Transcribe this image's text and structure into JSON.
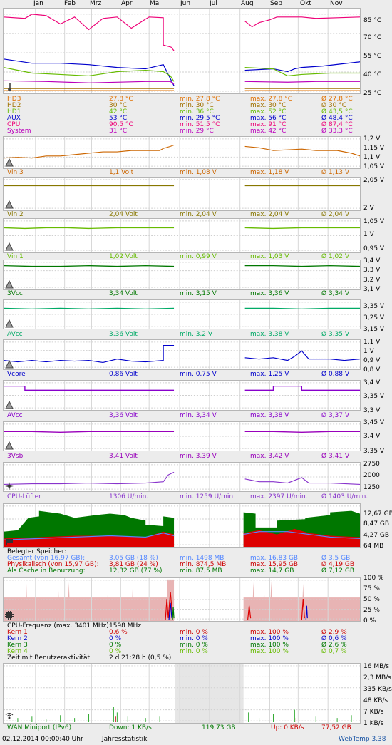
{
  "months": [
    "Jan",
    "Feb",
    "Mrz",
    "Apr",
    "Mai",
    "Jun",
    "Jul",
    "Aug",
    "Sep",
    "Okt",
    "Nov"
  ],
  "temp": {
    "ticks": [
      "85 °C",
      "70 °C",
      "55 °C",
      "40 °C",
      "25 °C"
    ],
    "rows": [
      {
        "name": "HD3",
        "cur": "27,8 °C",
        "min": "min. 27,8 °C",
        "max": "max. 27,8 °C",
        "avg": "Ø 27,8 °C",
        "color": "#e07000"
      },
      {
        "name": "HD2",
        "cur": "30 °C",
        "min": "min. 30 °C",
        "max": "max. 30 °C",
        "avg": "Ø 30 °C",
        "color": "#a07000"
      },
      {
        "name": "HD1",
        "cur": "42 °C",
        "min": "min. 36 °C",
        "max": "max. 52 °C",
        "avg": "Ø 43,5 °C",
        "color": "#66bb00"
      },
      {
        "name": "AUX",
        "cur": "53 °C",
        "min": "min. 29,5 °C",
        "max": "max. 56 °C",
        "avg": "Ø 48,4 °C",
        "color": "#0000cc"
      },
      {
        "name": "CPU",
        "cur": "90,5 °C",
        "min": "min. 51,5 °C",
        "max": "max. 91 °C",
        "avg": "Ø 87,4 °C",
        "color": "#ee0077"
      },
      {
        "name": "System",
        "cur": "31 °C",
        "min": "min. 29 °C",
        "max": "max. 42 °C",
        "avg": "Ø 33,3 °C",
        "color": "#bb00bb"
      }
    ]
  },
  "volts": [
    {
      "name": "Vin 3",
      "cur": "1,1 Volt",
      "min": "min. 1,08 V",
      "max": "max. 1,18 V",
      "avg": "Ø 1,13 V",
      "color": "#cc6600",
      "ticks": [
        "1,2 V",
        "1,15 V",
        "1,1 V",
        "1,05 V"
      ]
    },
    {
      "name": "Vin 2",
      "cur": "2,04 Volt",
      "min": "min. 2,04 V",
      "max": "max. 2,04 V",
      "avg": "Ø 2,04 V",
      "color": "#887700",
      "ticks": [
        "2,05 V",
        "2 V"
      ]
    },
    {
      "name": "Vin 1",
      "cur": "1,02 Volt",
      "min": "min. 0,99 V",
      "max": "max. 1,03 V",
      "avg": "Ø 1,02 V",
      "color": "#66bb00",
      "ticks": [
        "1,05 V",
        "1 V",
        "0,95 V"
      ]
    },
    {
      "name": "3Vcc",
      "cur": "3,34 Volt",
      "min": "min. 3,15 V",
      "max": "max. 3,36 V",
      "avg": "Ø 3,34 V",
      "color": "#007700",
      "ticks": [
        "3,4 V",
        "3,3 V",
        "3,2 V",
        "3,1 V"
      ]
    },
    {
      "name": "AVcc",
      "cur": "3,36 Volt",
      "min": "min. 3,2 V",
      "max": "max. 3,38 V",
      "avg": "Ø 3,35 V",
      "color": "#00aa66",
      "ticks": [
        "3,35 V",
        "3,25 V",
        "3,15 V"
      ]
    },
    {
      "name": "Vcore",
      "cur": "0,86 Volt",
      "min": "min. 0,75 V",
      "max": "max. 1,25 V",
      "avg": "Ø 0,88 V",
      "color": "#0000cc",
      "ticks": [
        "1,1 V",
        "1 V",
        "0,9 V",
        "0,8 V"
      ]
    },
    {
      "name": "AVcc",
      "cur": "3,36 Volt",
      "min": "min. 3,34 V",
      "max": "max. 3,38 V",
      "avg": "Ø 3,37 V",
      "color": "#8800cc",
      "ticks": [
        "3,4 V",
        "3,35 V",
        "3,3 V"
      ]
    },
    {
      "name": "3Vsb",
      "cur": "3,41 Volt",
      "min": "min. 3,39 V",
      "max": "max. 3,42 V",
      "avg": "Ø 3,41 V",
      "color": "#9900bb",
      "ticks": [
        "3,45 V",
        "3,4 V",
        "3,35 V"
      ]
    }
  ],
  "fan": {
    "name": "CPU-Lüfter",
    "cur": "1306 U/min.",
    "min": "min. 1259 U/min.",
    "max": "max. 2397 U/min.",
    "avg": "Ø 1403 U/min.",
    "color": "#8833cc",
    "ticks": [
      "2750",
      "2000",
      "1250"
    ]
  },
  "mem": {
    "ticks": [
      "12,67 GB",
      "8,47 GB",
      "4,27 GB",
      "64 MB"
    ],
    "title": "Belegter Speicher:",
    "rows": [
      {
        "name": "Gesamt (von 16,97 GB):",
        "cur": "3,05 GB (18 %)",
        "min": "min. 1498 MB",
        "max": "max. 16,83 GB",
        "avg": "Ø 3,5 GB",
        "color": "#5588ff"
      },
      {
        "name": "Physikalisch (von 15,97 GB):",
        "cur": "3,81 GB (24 %)",
        "min": "min. 874,5 MB",
        "max": "max. 15,95 GB",
        "avg": "Ø 4,19 GB",
        "color": "#cc0000"
      },
      {
        "name": "Als Cache in Benutzung:",
        "cur": "12,32 GB (77 %)",
        "min": "min. 87,5 MB",
        "max": "max. 14,7 GB",
        "avg": "Ø 7,12 GB",
        "color": "#007700"
      }
    ]
  },
  "cpu": {
    "ticks": [
      "100 %",
      "75 %",
      "50 %",
      "25 %",
      "0 %"
    ],
    "title": "CPU-Frequenz (max. 3401 MHz):",
    "freq": "1598 MHz",
    "rows": [
      {
        "name": "Kern 1",
        "cur": "0,6 %",
        "min": "min. 0 %",
        "max": "max. 100 %",
        "avg": "Ø 2,9 %",
        "color": "#cc0000"
      },
      {
        "name": "Kern 2",
        "cur": "0 %",
        "min": "min. 0 %",
        "max": "max. 100 %",
        "avg": "Ø 0,6 %",
        "color": "#0000cc"
      },
      {
        "name": "Kern 3",
        "cur": "0 %",
        "min": "min. 0 %",
        "max": "max. 100 %",
        "avg": "Ø 2,6 %",
        "color": "#007700"
      },
      {
        "name": "Kern 4",
        "cur": "0 %",
        "min": "min. 0 %",
        "max": "max. 100 %",
        "avg": "Ø 0,7 %",
        "color": "#66bb00"
      }
    ],
    "activity_label": "Zeit mit Benutzeraktivität:",
    "activity_value": "2 d 21:28 h (0,5 %)"
  },
  "net": {
    "ticks": [
      "16 MB/s",
      "2,3 MB/s",
      "335 KB/s",
      "48 KB/s",
      "7 KB/s",
      "1 KB/s"
    ],
    "name": "WAN Miniport (IPv6)",
    "down": "Down: 1 KB/s",
    "down_total": "119,73 GB",
    "up": "Up: 0 KB/s",
    "up_total": "77,52 GB"
  },
  "footer": {
    "timestamp": "02.12.2014 00:00:40 Uhr",
    "view": "Jahresstatistik",
    "brand": "WebTemp 3.38"
  }
}
